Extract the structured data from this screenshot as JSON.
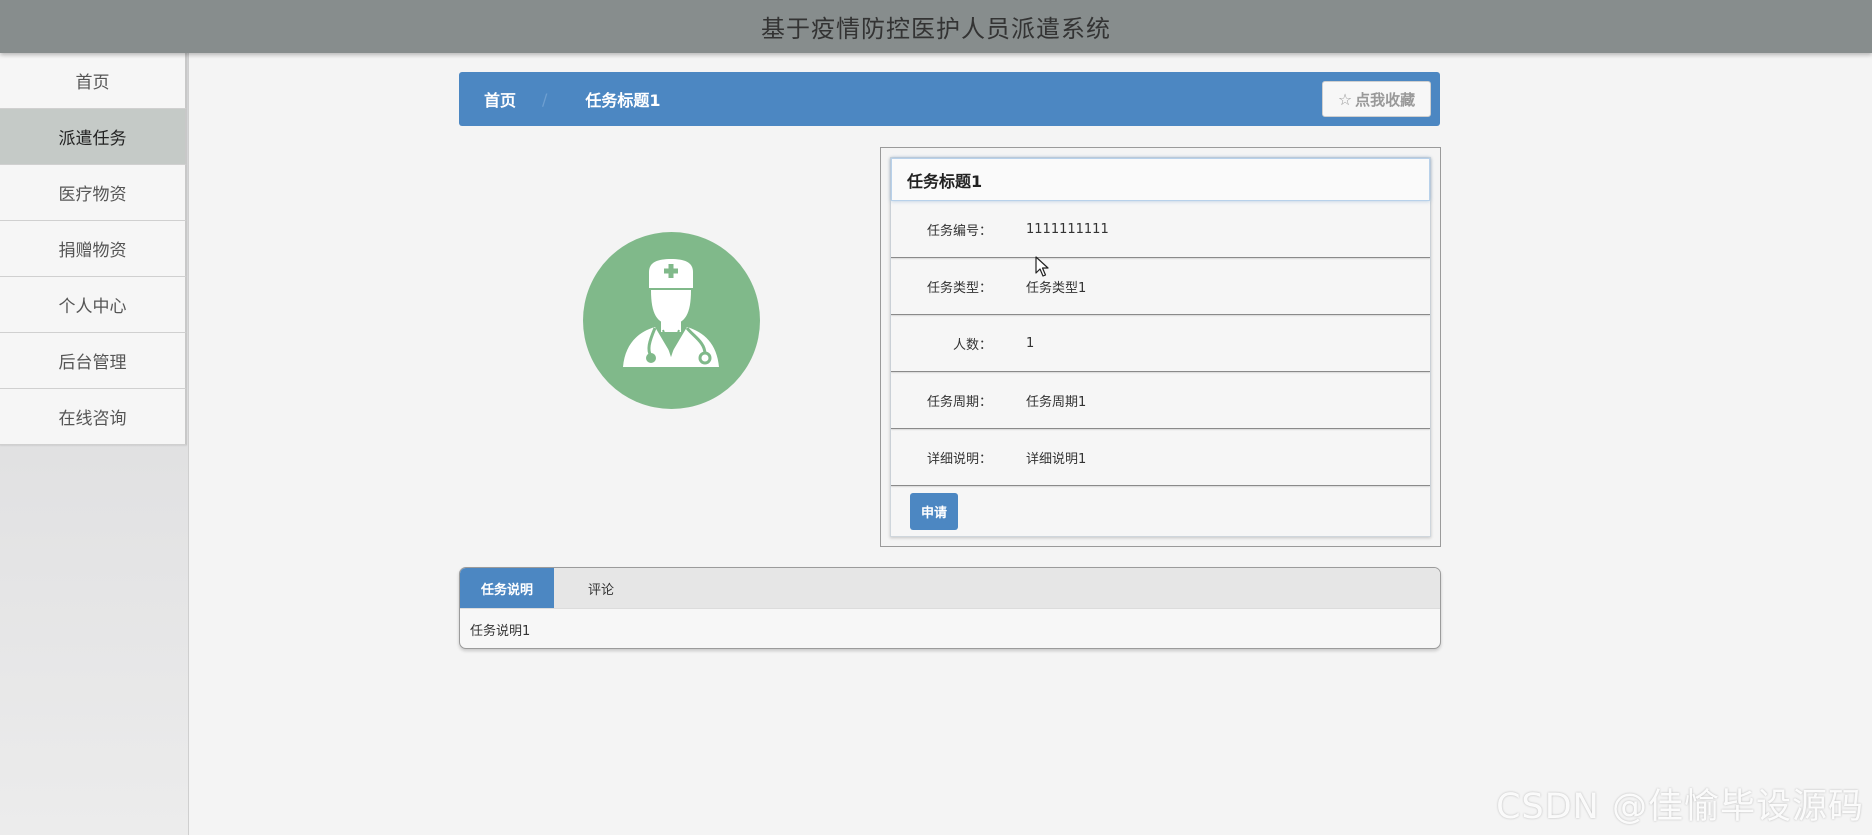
{
  "header": {
    "title": "基于疫情防控医护人员派遣系统"
  },
  "sidebar": {
    "items": [
      {
        "label": "首页"
      },
      {
        "label": "派遣任务",
        "active": true
      },
      {
        "label": "医疗物资"
      },
      {
        "label": "捐赠物资"
      },
      {
        "label": "个人中心"
      },
      {
        "label": "后台管理"
      },
      {
        "label": "在线咨询"
      }
    ]
  },
  "breadcrumb": {
    "home": "首页",
    "separator": "/",
    "current": "任务标题1",
    "favorite_label": "点我收藏",
    "favorite_icon": "star-outline-icon"
  },
  "avatar": {
    "icon": "doctor-icon",
    "color": "#80b98a"
  },
  "detail": {
    "title": "任务标题1",
    "rows": [
      {
        "label": "任务编号：",
        "value": "1111111111"
      },
      {
        "label": "任务类型：",
        "value": "任务类型1"
      },
      {
        "label": "人数：",
        "value": "1"
      },
      {
        "label": "任务周期：",
        "value": "任务周期1"
      },
      {
        "label": "详细说明：",
        "value": "详细说明1"
      }
    ],
    "apply_label": "申请"
  },
  "tabs": {
    "items": [
      {
        "label": "任务说明",
        "active": true
      },
      {
        "label": "评论"
      }
    ],
    "content": "任务说明1"
  },
  "watermark": "CSDN @佳愉毕设源码",
  "colors": {
    "header_bg": "#878d8d",
    "accent": "#4c87c2",
    "avatar_bg": "#80b98a",
    "active_menu_bg": "#c5cac7"
  }
}
